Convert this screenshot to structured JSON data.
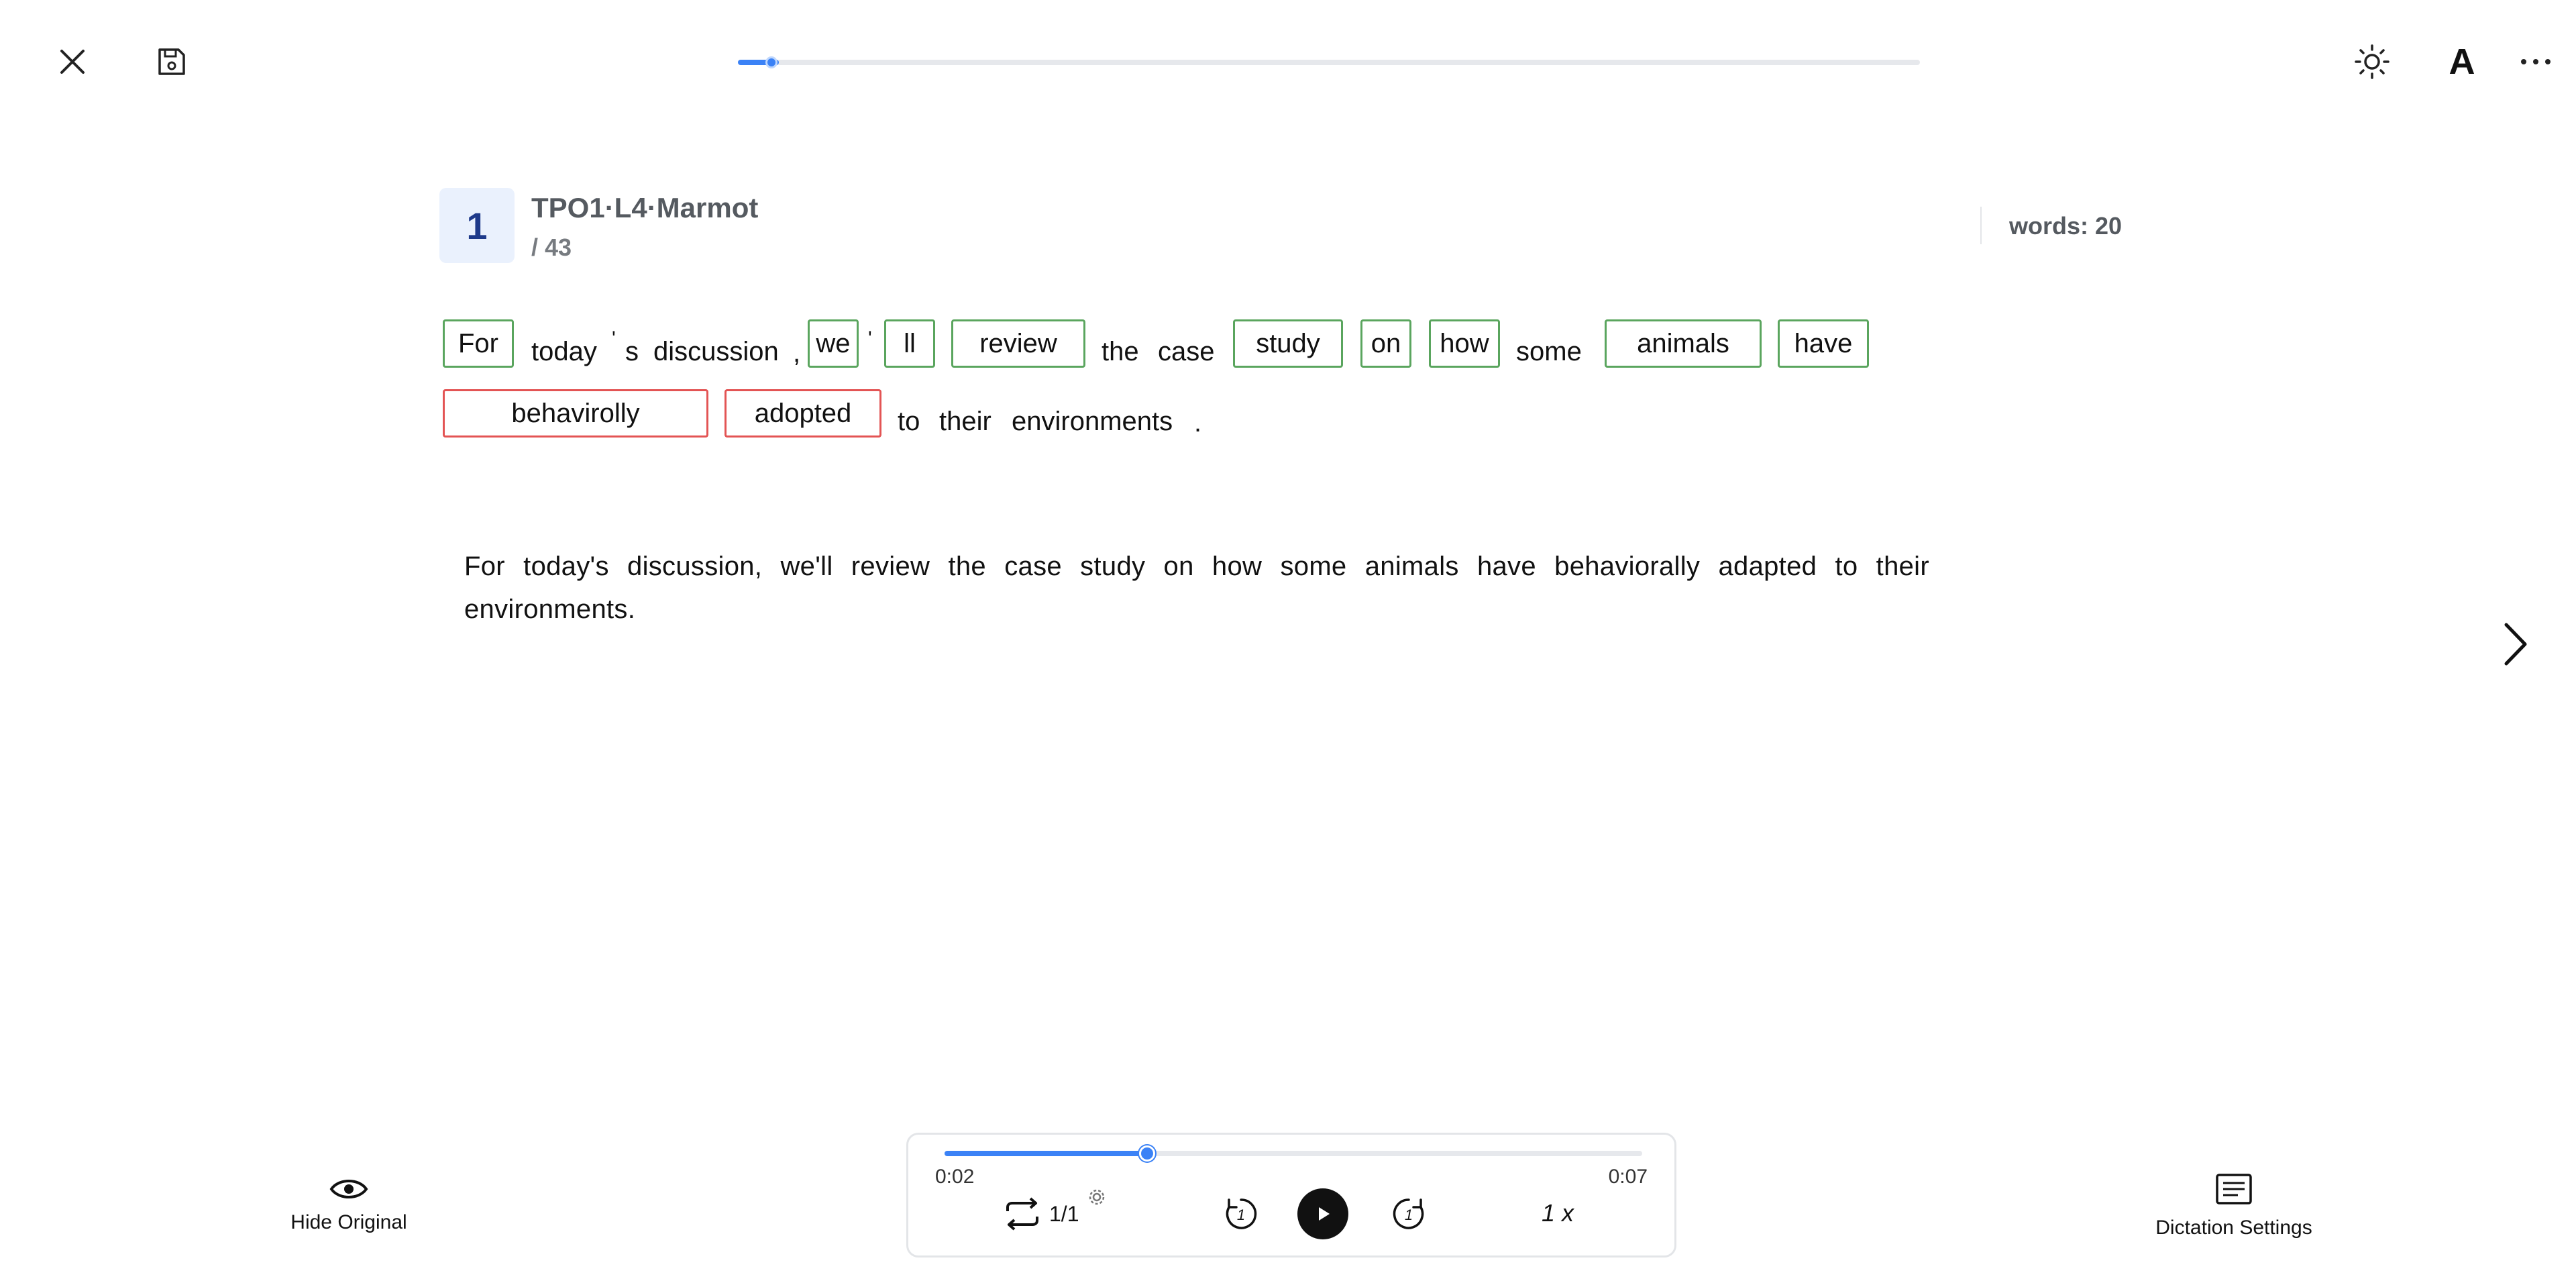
{
  "topbar": {
    "progress_fraction": 0.023
  },
  "lesson": {
    "index": "1",
    "title": "TPO1·L4·Marmot",
    "total": "/ 43",
    "words": "words: 20"
  },
  "row1": [
    {
      "t": "For",
      "kind": "correct"
    },
    {
      "t": "today",
      "kind": "text"
    },
    {
      "t": "'",
      "kind": "punct"
    },
    {
      "t": "s",
      "kind": "text"
    },
    {
      "t": "discussion",
      "kind": "text"
    },
    {
      "t": ",",
      "kind": "punct"
    },
    {
      "t": "we",
      "kind": "correct"
    },
    {
      "t": "'",
      "kind": "punct"
    },
    {
      "t": "ll",
      "kind": "correct"
    },
    {
      "t": "review",
      "kind": "correct"
    },
    {
      "t": "the",
      "kind": "text"
    },
    {
      "t": "case",
      "kind": "text"
    },
    {
      "t": "study",
      "kind": "correct"
    },
    {
      "t": "on",
      "kind": "correct"
    },
    {
      "t": "how",
      "kind": "correct"
    },
    {
      "t": "some",
      "kind": "text"
    },
    {
      "t": "animals",
      "kind": "correct"
    },
    {
      "t": "have",
      "kind": "correct"
    }
  ],
  "row2": [
    {
      "t": "behavirolly",
      "kind": "wrong"
    },
    {
      "t": "adopted",
      "kind": "wrong"
    },
    {
      "t": "to",
      "kind": "text"
    },
    {
      "t": "their",
      "kind": "text"
    },
    {
      "t": "environments",
      "kind": "text"
    },
    {
      "t": ".",
      "kind": "punct"
    }
  ],
  "original_text": "For today's discussion, we'll review the case study on how some animals have behaviorally adapted to their environments.",
  "bottom": {
    "hide_original_label": "Hide Original",
    "dictation_settings_label": "Dictation Settings"
  },
  "player": {
    "current_time": "0:02",
    "total_time": "0:07",
    "progress_fraction": 0.29,
    "loop_count": "1/1",
    "speed": "1 x"
  },
  "colors": {
    "accent": "#3b82f6",
    "correct_border": "#5aa55e",
    "wrong_border": "#e35454"
  }
}
